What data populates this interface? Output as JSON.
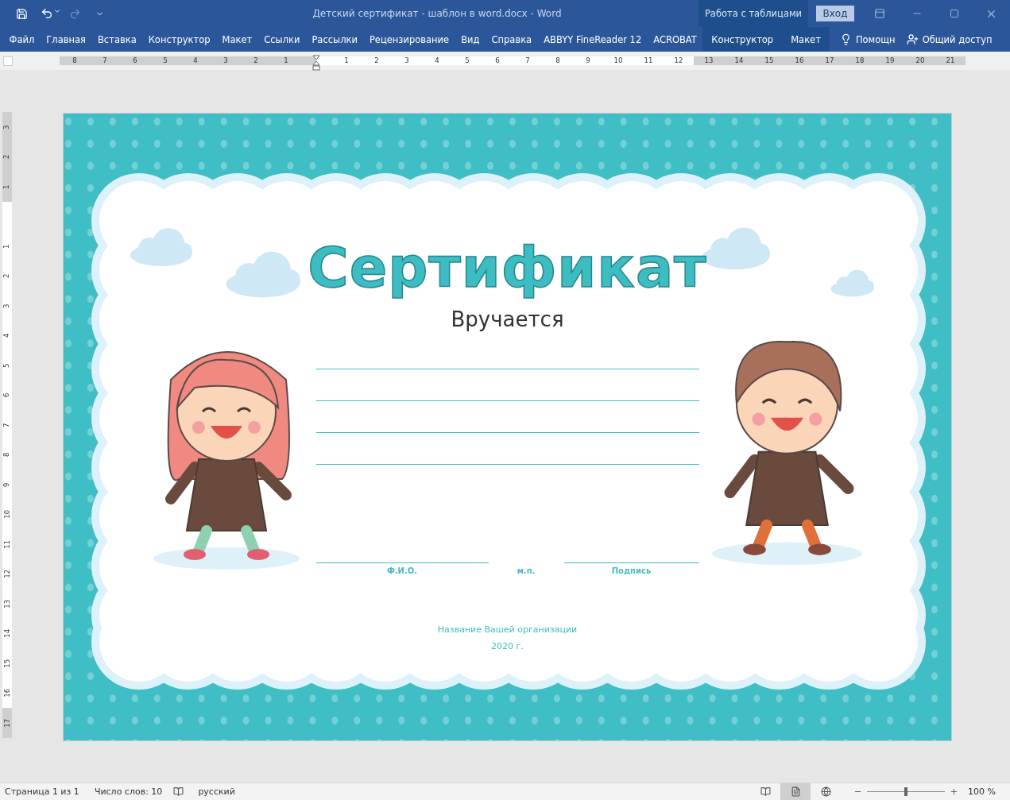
{
  "window": {
    "title": "Детский сертификат - шаблон в word.docx  -  Word",
    "context_group": "Работа с таблицами",
    "sign_in": "Вход"
  },
  "ribbon_tabs": [
    {
      "label": "Файл",
      "contextual": false
    },
    {
      "label": "Главная",
      "contextual": false
    },
    {
      "label": "Вставка",
      "contextual": false
    },
    {
      "label": "Конструктор",
      "contextual": false
    },
    {
      "label": "Макет",
      "contextual": false
    },
    {
      "label": "Ссылки",
      "contextual": false
    },
    {
      "label": "Рассылки",
      "contextual": false
    },
    {
      "label": "Рецензирование",
      "contextual": false
    },
    {
      "label": "Вид",
      "contextual": false
    },
    {
      "label": "Справка",
      "contextual": false
    },
    {
      "label": "ABBYY FineReader 12",
      "contextual": false
    },
    {
      "label": "ACROBAT",
      "contextual": false
    },
    {
      "label": "Конструктор",
      "contextual": true
    },
    {
      "label": "Макет",
      "contextual": true
    }
  ],
  "help": "Помощн",
  "share": "Общий доступ",
  "ruler": {
    "horizontal": [
      {
        "label": "8",
        "margin": true
      },
      {
        "label": "7",
        "margin": true
      },
      {
        "label": "6",
        "margin": true
      },
      {
        "label": "5",
        "margin": true
      },
      {
        "label": "4",
        "margin": true
      },
      {
        "label": "3",
        "margin": true
      },
      {
        "label": "2",
        "margin": true
      },
      {
        "label": "1",
        "margin": true
      },
      {
        "label": "1",
        "margin": false
      },
      {
        "label": "2",
        "margin": false
      },
      {
        "label": "3",
        "margin": false
      },
      {
        "label": "4",
        "margin": false
      },
      {
        "label": "5",
        "margin": false
      },
      {
        "label": "6",
        "margin": false
      },
      {
        "label": "7",
        "margin": false
      },
      {
        "label": "8",
        "margin": false
      },
      {
        "label": "9",
        "margin": false
      },
      {
        "label": "10",
        "margin": false
      },
      {
        "label": "11",
        "margin": false
      },
      {
        "label": "12",
        "margin": false
      },
      {
        "label": "13",
        "margin": true
      },
      {
        "label": "14",
        "margin": true
      },
      {
        "label": "15",
        "margin": true
      },
      {
        "label": "16",
        "margin": true
      },
      {
        "label": "17",
        "margin": true
      },
      {
        "label": "18",
        "margin": true
      },
      {
        "label": "19",
        "margin": true
      },
      {
        "label": "20",
        "margin": true
      },
      {
        "label": "21",
        "margin": true
      }
    ],
    "vertical": [
      {
        "label": "3",
        "margin": true
      },
      {
        "label": "2",
        "margin": true
      },
      {
        "label": "1",
        "margin": true
      },
      {
        "label": "1",
        "margin": false
      },
      {
        "label": "2",
        "margin": false
      },
      {
        "label": "3",
        "margin": false
      },
      {
        "label": "4",
        "margin": false
      },
      {
        "label": "5",
        "margin": false
      },
      {
        "label": "6",
        "margin": false
      },
      {
        "label": "7",
        "margin": false
      },
      {
        "label": "8",
        "margin": false
      },
      {
        "label": "9",
        "margin": false
      },
      {
        "label": "10",
        "margin": false
      },
      {
        "label": "11",
        "margin": false
      },
      {
        "label": "12",
        "margin": false
      },
      {
        "label": "13",
        "margin": false
      },
      {
        "label": "14",
        "margin": false
      },
      {
        "label": "15",
        "margin": false
      },
      {
        "label": "16",
        "margin": false
      },
      {
        "label": "17",
        "margin": true
      }
    ]
  },
  "certificate": {
    "title": "Сертификат",
    "subtitle": "Вручается",
    "signature_labels": [
      "Ф.И.О.",
      "м.п.",
      "Подпись"
    ],
    "organization": "Название Вашей организации",
    "year": "2020 г."
  },
  "status_bar": {
    "page": "Страница 1 из 1",
    "words": "Число слов: 10",
    "language": "русский",
    "views": [
      {
        "kind": "read",
        "selected": false
      },
      {
        "kind": "print",
        "selected": true
      },
      {
        "kind": "web",
        "selected": false
      }
    ],
    "zoom": {
      "level": 0.5,
      "reading": "100 %"
    }
  }
}
